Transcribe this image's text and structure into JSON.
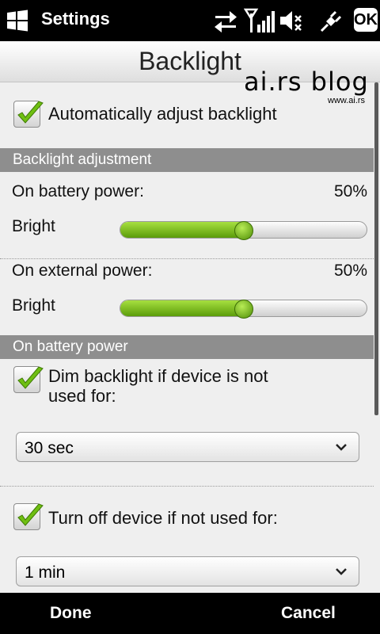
{
  "statusbar": {
    "app_title": "Settings",
    "icons": [
      "windows-start-icon",
      "sync-arrows-icon",
      "signal-icon",
      "speaker-muted-icon",
      "usb-plug-icon"
    ],
    "ok_label": "OK"
  },
  "header": {
    "title": "Backlight"
  },
  "watermark": {
    "main": "ai.rs blog",
    "small": "www.ai.rs"
  },
  "auto_adjust": {
    "label": "Automatically adjust backlight",
    "checked": true
  },
  "sections": {
    "adjustment": "Backlight adjustment",
    "battery": "On battery power"
  },
  "battery_row": {
    "label": "On battery power:",
    "percent": "50%",
    "slider_label": "Bright",
    "level": 0.5
  },
  "external_row": {
    "label": "On external power:",
    "percent": "50%",
    "slider_label": "Bright",
    "level": 0.5
  },
  "dim_option": {
    "label_line1": "Dim backlight if device is not",
    "label_line2": "used for:",
    "checked": true,
    "value": "30 sec"
  },
  "off_option": {
    "label": "Turn off device if not used for:",
    "checked": true,
    "value": "1 min"
  },
  "softkeys": {
    "left": "Done",
    "right": "Cancel"
  },
  "colors": {
    "accent_green": "#7cc21a",
    "section_gray": "#8e8e8e"
  }
}
